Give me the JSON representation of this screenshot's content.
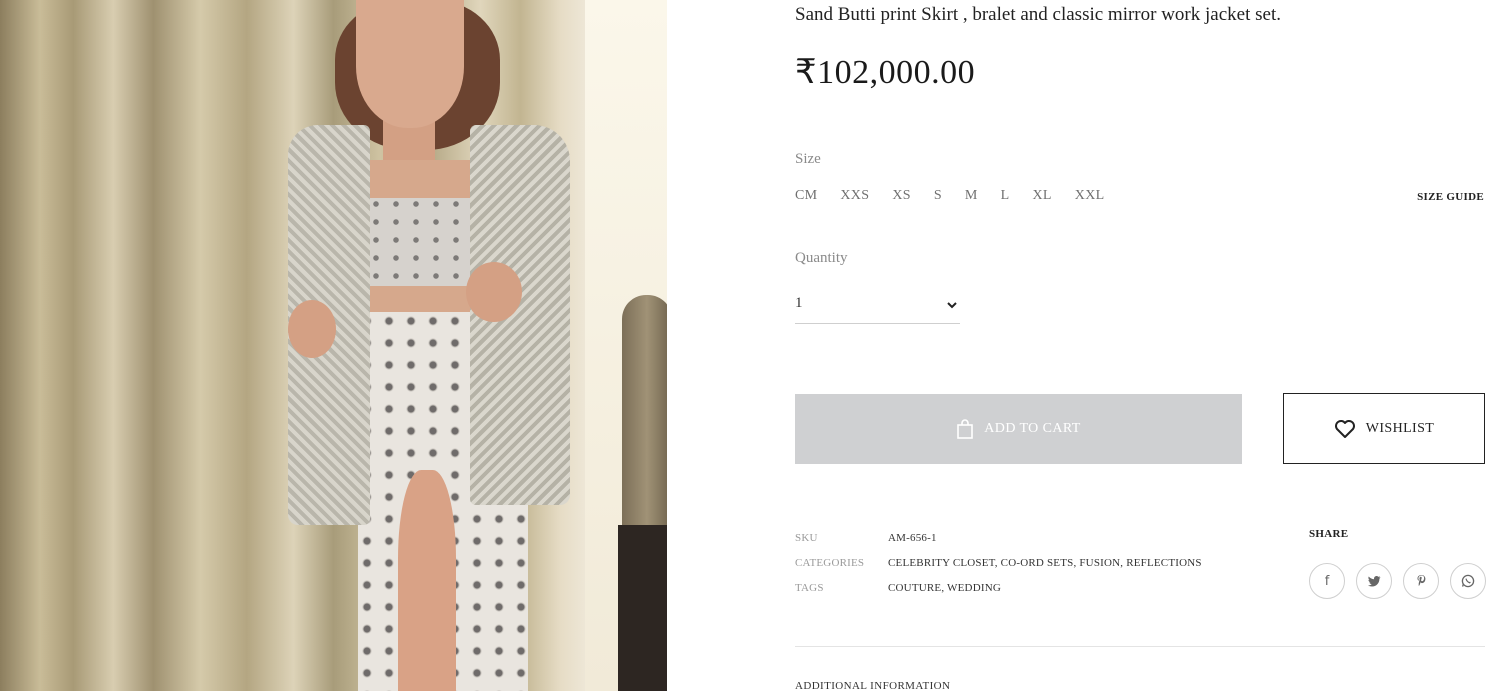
{
  "product": {
    "title": "Sand Butti print Skirt , bralet and classic mirror work jacket set.",
    "price": "₹102,000.00",
    "size_label": "Size",
    "sizes": [
      "CM",
      "XXS",
      "XS",
      "S",
      "M",
      "L",
      "XL",
      "XXL"
    ],
    "size_guide": "SIZE GUIDE",
    "quantity_label": "Quantity",
    "quantity_value": "1"
  },
  "actions": {
    "add_to_cart": "ADD TO CART",
    "wishlist": "WISHLIST"
  },
  "meta": {
    "sku_label": "SKU",
    "sku_value": "AM-656-1",
    "categories_label": "CATEGORIES",
    "categories_value": "CELEBRITY CLOSET, CO-ORD SETS, FUSION, REFLECTIONS",
    "tags_label": "TAGS",
    "tags_value": "COUTURE, WEDDING"
  },
  "share": {
    "label": "SHARE",
    "icons": [
      "facebook-icon",
      "twitter-icon",
      "pinterest-icon",
      "whatsapp-icon"
    ]
  },
  "tabs": {
    "additional_information": "ADDITIONAL INFORMATION"
  },
  "colors": {
    "add_to_cart_bg": "#cfd0d2",
    "text": "#222222"
  }
}
